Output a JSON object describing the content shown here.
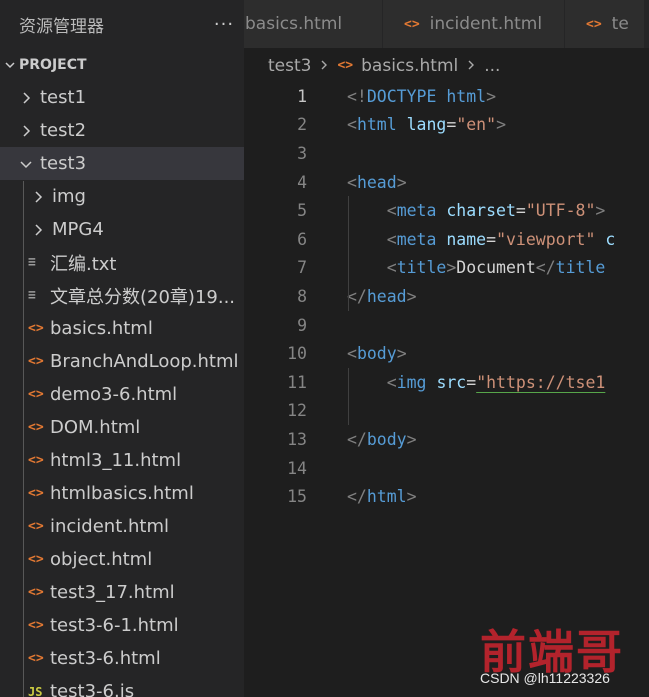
{
  "sidebar": {
    "title": "资源管理器",
    "more": "···",
    "project_label": "PROJECT",
    "items": [
      {
        "label": "test1",
        "kind": "folder",
        "expanded": false,
        "depth": 0
      },
      {
        "label": "test2",
        "kind": "folder",
        "expanded": false,
        "depth": 0
      },
      {
        "label": "test3",
        "kind": "folder",
        "expanded": true,
        "depth": 0,
        "selected": true
      },
      {
        "label": "img",
        "kind": "folder",
        "expanded": false,
        "depth": 1
      },
      {
        "label": "MPG4",
        "kind": "folder",
        "expanded": false,
        "depth": 1
      },
      {
        "label": "汇编.txt",
        "kind": "txt",
        "depth": 1
      },
      {
        "label": "文章总分数(20章)19...",
        "kind": "txt",
        "depth": 1
      },
      {
        "label": "basics.html",
        "kind": "html",
        "depth": 1
      },
      {
        "label": "BranchAndLoop.html",
        "kind": "html",
        "depth": 1
      },
      {
        "label": "demo3-6.html",
        "kind": "html",
        "depth": 1
      },
      {
        "label": "DOM.html",
        "kind": "html",
        "depth": 1
      },
      {
        "label": "html3_11.html",
        "kind": "html",
        "depth": 1
      },
      {
        "label": "htmlbasics.html",
        "kind": "html",
        "depth": 1
      },
      {
        "label": "incident.html",
        "kind": "html",
        "depth": 1
      },
      {
        "label": "object.html",
        "kind": "html",
        "depth": 1
      },
      {
        "label": "test3_17.html",
        "kind": "html",
        "depth": 1
      },
      {
        "label": "test3-6-1.html",
        "kind": "html",
        "depth": 1
      },
      {
        "label": "test3-6.html",
        "kind": "html",
        "depth": 1
      },
      {
        "label": "test3-6.js",
        "kind": "js",
        "depth": 1
      }
    ]
  },
  "icons": {
    "html": "<>",
    "js": "JS",
    "txt": "≡"
  },
  "tabs": [
    {
      "label": "basics.html",
      "icon": false
    },
    {
      "label": "incident.html",
      "icon": true
    },
    {
      "label": "te",
      "icon": true
    }
  ],
  "breadcrumb": {
    "folder": "test3",
    "file": "basics.html",
    "tail": "..."
  },
  "editor": {
    "active_line": 1,
    "lines": [
      [
        [
          "punc",
          "<!"
        ],
        [
          "doctype",
          "DOCTYPE"
        ],
        [
          "text",
          " "
        ],
        [
          "tag",
          "html"
        ],
        [
          "punc",
          ">"
        ]
      ],
      [
        [
          "punc",
          "<"
        ],
        [
          "tag",
          "html"
        ],
        [
          "text",
          " "
        ],
        [
          "attr",
          "lang"
        ],
        [
          "text",
          "="
        ],
        [
          "str",
          "\"en\""
        ],
        [
          "punc",
          ">"
        ]
      ],
      [],
      [
        [
          "punc",
          "<"
        ],
        [
          "tag",
          "head"
        ],
        [
          "punc",
          ">"
        ]
      ],
      [
        [
          "text",
          "    "
        ],
        [
          "punc",
          "<"
        ],
        [
          "tag",
          "meta"
        ],
        [
          "text",
          " "
        ],
        [
          "attr",
          "charset"
        ],
        [
          "text",
          "="
        ],
        [
          "str",
          "\"UTF-8\""
        ],
        [
          "punc",
          ">"
        ]
      ],
      [
        [
          "text",
          "    "
        ],
        [
          "punc",
          "<"
        ],
        [
          "tag",
          "meta"
        ],
        [
          "text",
          " "
        ],
        [
          "attr",
          "name"
        ],
        [
          "text",
          "="
        ],
        [
          "str",
          "\"viewport\""
        ],
        [
          "text",
          " "
        ],
        [
          "attr",
          "c"
        ]
      ],
      [
        [
          "text",
          "    "
        ],
        [
          "punc",
          "<"
        ],
        [
          "tag",
          "title"
        ],
        [
          "punc",
          ">"
        ],
        [
          "text",
          "Document"
        ],
        [
          "punc",
          "</"
        ],
        [
          "tag",
          "title"
        ]
      ],
      [
        [
          "punc",
          "</"
        ],
        [
          "tag",
          "head"
        ],
        [
          "punc",
          ">"
        ]
      ],
      [],
      [
        [
          "punc",
          "<"
        ],
        [
          "tag",
          "body"
        ],
        [
          "punc",
          ">"
        ]
      ],
      [
        [
          "text",
          "    "
        ],
        [
          "punc",
          "<"
        ],
        [
          "tag",
          "img"
        ],
        [
          "text",
          " "
        ],
        [
          "attr",
          "src"
        ],
        [
          "text",
          "="
        ],
        [
          "str",
          "\"https://tse1",
          "squiggle"
        ]
      ],
      [],
      [
        [
          "punc",
          "</"
        ],
        [
          "tag",
          "body"
        ],
        [
          "punc",
          ">"
        ]
      ],
      [],
      [
        [
          "punc",
          "</"
        ],
        [
          "tag",
          "html"
        ],
        [
          "punc",
          ">"
        ]
      ]
    ]
  },
  "watermark": {
    "logo": "前端哥",
    "text": "CSDN @lh11223326"
  },
  "colors": {
    "sidebar_bg": "#252526",
    "editor_bg": "#1e1e1e",
    "selected_row": "#37373d",
    "html_icon": "#e37933",
    "tag": "#569cd6",
    "attr": "#9cdcfe",
    "string": "#ce9178",
    "watermark_red": "#b3232c"
  }
}
